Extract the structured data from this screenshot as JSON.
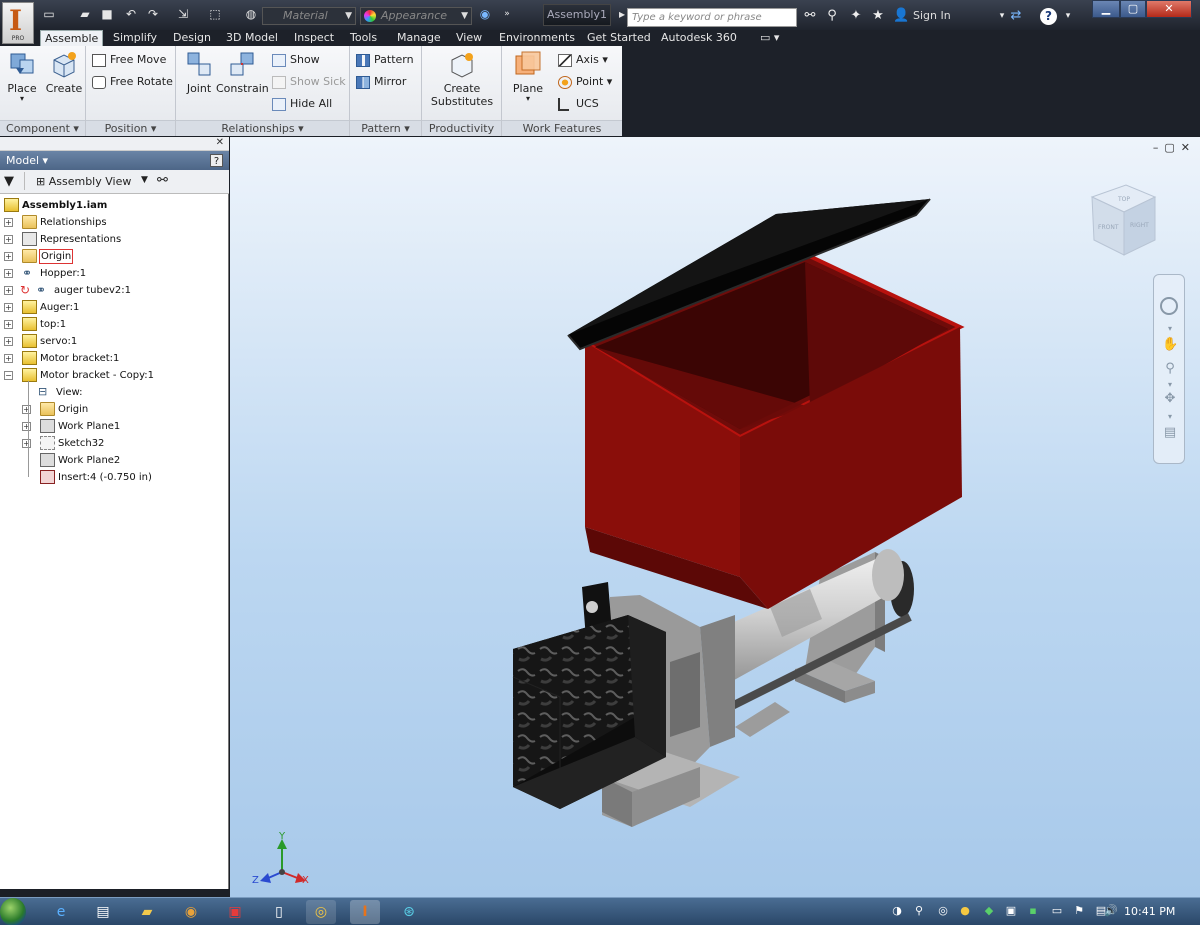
{
  "app": {
    "logo_letter": "I",
    "logo_sub": "PRO"
  },
  "title_bar": {
    "material": "Material",
    "appearance": "Appearance",
    "document_title": "Assembly1",
    "search_placeholder": "Type a keyword or phrase",
    "sign_in": "Sign In",
    "help": "?"
  },
  "ribbon_tabs": [
    "Assemble",
    "Simplify",
    "Design",
    "3D Model",
    "Inspect",
    "Tools",
    "Manage",
    "View",
    "Environments",
    "Get Started",
    "Autodesk 360"
  ],
  "ribbon": {
    "component": {
      "title": "Component",
      "place": "Place",
      "create": "Create"
    },
    "position": {
      "title": "Position",
      "free_move": "Free Move",
      "free_rotate": "Free Rotate"
    },
    "relationships": {
      "title": "Relationships",
      "joint": "Joint",
      "constrain": "Constrain",
      "show": "Show",
      "show_sick": "Show Sick",
      "hide_all": "Hide All"
    },
    "pattern": {
      "title": "Pattern",
      "pattern": "Pattern",
      "mirror": "Mirror"
    },
    "productivity": {
      "title": "Productivity",
      "create_substitutes": "Create Substitutes"
    },
    "work_features": {
      "title": "Work Features",
      "plane": "Plane",
      "axis": "Axis",
      "point": "Point",
      "ucs": "UCS"
    }
  },
  "browser": {
    "title": "Model",
    "view_mode": "Assembly View",
    "tree": [
      {
        "label": "Assembly1.iam",
        "icon": "assembly-icon",
        "bold": true
      },
      {
        "label": "Relationships",
        "icon": "folder-icon"
      },
      {
        "label": "Representations",
        "icon": "representations-icon"
      },
      {
        "label": "Origin",
        "icon": "folder-icon"
      },
      {
        "label": "Hopper:1",
        "icon": "part-link-icon"
      },
      {
        "label": "auger tubev2:1",
        "icon": "part-link-icon"
      },
      {
        "label": "Auger:1",
        "icon": "part-icon"
      },
      {
        "label": "top:1",
        "icon": "part-icon"
      },
      {
        "label": "servo:1",
        "icon": "part-icon"
      },
      {
        "label": "Motor bracket:1",
        "icon": "part-icon"
      },
      {
        "label": "Motor bracket - Copy:1",
        "icon": "part-icon"
      },
      {
        "label": "View:",
        "icon": "view-icon"
      },
      {
        "label": "Origin",
        "icon": "folder-icon"
      },
      {
        "label": "Work Plane1",
        "icon": "work-plane-icon"
      },
      {
        "label": "Sketch32",
        "icon": "sketch-icon"
      },
      {
        "label": "Work Plane2",
        "icon": "work-plane-icon"
      },
      {
        "label": "Insert:4 (-0.750 in)",
        "icon": "insert-constraint-icon"
      }
    ]
  },
  "viewcube": {
    "top": "TOP",
    "front": "FRONT",
    "right": "RIGHT"
  },
  "triad": {
    "x": "X",
    "y": "Y",
    "z": "Z"
  },
  "taskbar": {
    "clock": "10:41 PM"
  },
  "colors": {
    "hopper": "#8a0e0a",
    "lid": "#0c0c0c",
    "bracket": "#9c9c9c",
    "tube": "#c8c8c8",
    "viewport_top": "#eef4fb",
    "viewport_bottom": "#a8c9ea"
  }
}
